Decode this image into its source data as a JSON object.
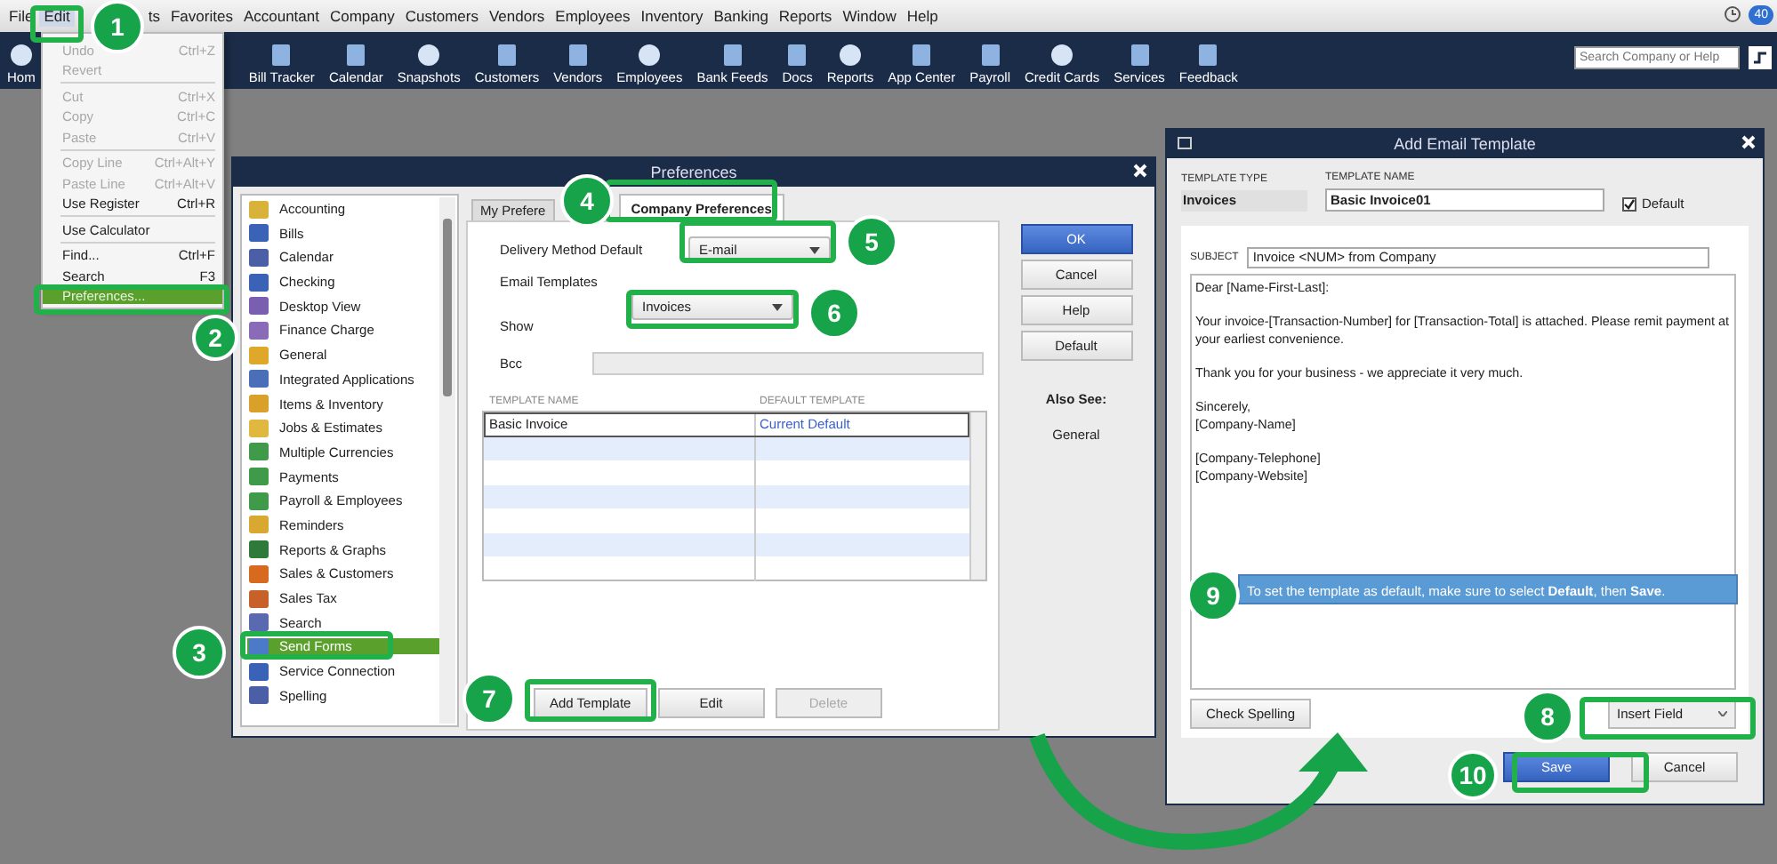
{
  "menu_bar": {
    "items": [
      {
        "label": "File",
        "selected": false
      },
      {
        "label": "Edit",
        "selected": true
      },
      {
        "label": "ts",
        "selected": false
      },
      {
        "label": "Favorites",
        "selected": false
      },
      {
        "label": "Accountant",
        "selected": false
      },
      {
        "label": "Company",
        "selected": false
      },
      {
        "label": "Customers",
        "selected": false
      },
      {
        "label": "Vendors",
        "selected": false
      },
      {
        "label": "Employees",
        "selected": false
      },
      {
        "label": "Inventory",
        "selected": false
      },
      {
        "label": "Banking",
        "selected": false
      },
      {
        "label": "Reports",
        "selected": false
      },
      {
        "label": "Window",
        "selected": false
      },
      {
        "label": "Help",
        "selected": false
      }
    ],
    "badge": "40"
  },
  "toolbar": {
    "items": [
      "Hom",
      "Bill Tracker",
      "Calendar",
      "Snapshots",
      "Customers",
      "Vendors",
      "Employees",
      "Bank Feeds",
      "Docs",
      "Reports",
      "App Center",
      "Payroll",
      "Credit Cards",
      "Services",
      "Feedback"
    ],
    "search": {
      "placeholder": "Search Company or Help"
    }
  },
  "edit_menu": {
    "items": [
      {
        "kind": "item",
        "label": "Undo",
        "shortcut": "Ctrl+Z",
        "disabled": true,
        "selected": false
      },
      {
        "kind": "item",
        "label": "Revert",
        "disabled": true,
        "selected": false
      },
      {
        "kind": "separator"
      },
      {
        "kind": "item",
        "label": "Cut",
        "shortcut": "Ctrl+X",
        "disabled": true,
        "selected": false
      },
      {
        "kind": "item",
        "label": "Copy",
        "shortcut": "Ctrl+C",
        "disabled": true,
        "selected": false
      },
      {
        "kind": "item",
        "label": "Paste",
        "shortcut": "Ctrl+V",
        "disabled": true,
        "selected": false
      },
      {
        "kind": "separator"
      },
      {
        "kind": "item",
        "label": "Copy Line",
        "shortcut": "Ctrl+Alt+Y",
        "disabled": true,
        "selected": false
      },
      {
        "kind": "item",
        "label": "Paste Line",
        "shortcut": "Ctrl+Alt+V",
        "disabled": true,
        "selected": false
      },
      {
        "kind": "item",
        "label": "Use Register",
        "shortcut": "Ctrl+R",
        "disabled": false,
        "selected": false
      },
      {
        "kind": "separator"
      },
      {
        "kind": "item",
        "label": "Use Calculator",
        "disabled": false,
        "selected": false
      },
      {
        "kind": "separator"
      },
      {
        "kind": "item",
        "label": "Find...",
        "shortcut": "Ctrl+F",
        "disabled": false,
        "selected": false
      },
      {
        "kind": "item",
        "label": "Search",
        "shortcut": "F3",
        "disabled": false,
        "selected": false
      },
      {
        "kind": "item",
        "label": "Preferences...",
        "disabled": false,
        "selected": true
      }
    ]
  },
  "preferences": {
    "title": "Preferences",
    "categories": [
      {
        "label": "Accounting",
        "selected": false
      },
      {
        "label": "Bills",
        "selected": false
      },
      {
        "label": "Calendar",
        "selected": false
      },
      {
        "label": "Checking",
        "selected": false
      },
      {
        "label": "Desktop View",
        "selected": false
      },
      {
        "label": "Finance Charge",
        "selected": false
      },
      {
        "label": "General",
        "selected": false
      },
      {
        "label": "Integrated Applications",
        "selected": false
      },
      {
        "label": "Items & Inventory",
        "selected": false
      },
      {
        "label": "Jobs & Estimates",
        "selected": false
      },
      {
        "label": "Multiple Currencies",
        "selected": false
      },
      {
        "label": "Payments",
        "selected": false
      },
      {
        "label": "Payroll & Employees",
        "selected": false
      },
      {
        "label": "Reminders",
        "selected": false
      },
      {
        "label": "Reports & Graphs",
        "selected": false
      },
      {
        "label": "Sales & Customers",
        "selected": false
      },
      {
        "label": "Sales Tax",
        "selected": false
      },
      {
        "label": "Search",
        "selected": false
      },
      {
        "label": "Send Forms",
        "selected": true
      },
      {
        "label": "Service Connection",
        "selected": false
      },
      {
        "label": "Spelling",
        "selected": false
      }
    ],
    "tabs": [
      {
        "label": "My Prefere",
        "selected": false
      },
      {
        "label": "Company Preferences",
        "selected": true
      }
    ],
    "delivery_method": {
      "label": "Delivery Method Default",
      "value": "E-mail"
    },
    "email_templates_label": "Email Templates",
    "show": {
      "label": "Show",
      "value": "Invoices"
    },
    "bcc": {
      "label": "Bcc"
    },
    "table": {
      "columns": [
        "TEMPLATE NAME",
        "DEFAULT TEMPLATE"
      ],
      "rows": [
        {
          "name": "Basic Invoice",
          "default_template": "Current Default"
        }
      ]
    },
    "buttons": [
      {
        "label": "Add Template",
        "disabled": false
      },
      {
        "label": "Edit",
        "disabled": false
      },
      {
        "label": "Delete",
        "disabled": true
      }
    ],
    "side_buttons": [
      {
        "label": "OK",
        "primary": true
      },
      {
        "label": "Cancel",
        "primary": false
      },
      {
        "label": "Help",
        "primary": false
      },
      {
        "label": "Default",
        "primary": false
      }
    ],
    "also_see": {
      "title": "Also See:",
      "links": [
        "General"
      ]
    }
  },
  "email_template": {
    "title": "Add Email Template",
    "template_type_label": "TEMPLATE TYPE",
    "template_type": "Invoices",
    "template_name_label": "TEMPLATE NAME",
    "template_name": "Basic Invoice01",
    "default_checkbox": {
      "label": "Default",
      "checked": true
    },
    "subject_label": "SUBJECT",
    "subject": "Invoice <NUM> from Company",
    "body": [
      [
        "Dear [Name-First-Last]:"
      ],
      [
        "Your invoice-[Transaction-Number] for [Transaction-Total] is attached. Please remit payment at your earliest convenience."
      ],
      [
        "Thank you for your business - we appreciate it very much."
      ],
      [
        "Sincerely,",
        "[Company-Name]"
      ],
      [
        "[Company-Telephone]",
        "[Company-Website]"
      ]
    ],
    "tip": "To set the template as default, make sure to select **Default**, then **Save**.",
    "check_spelling": "Check Spelling",
    "insert_field": "Insert Field",
    "buttons": [
      {
        "label": "Save",
        "primary": true
      },
      {
        "label": "Cancel",
        "primary": false
      }
    ]
  },
  "callouts": [
    "1",
    "2",
    "3",
    "4",
    "5",
    "6",
    "7",
    "8",
    "9",
    "10"
  ]
}
